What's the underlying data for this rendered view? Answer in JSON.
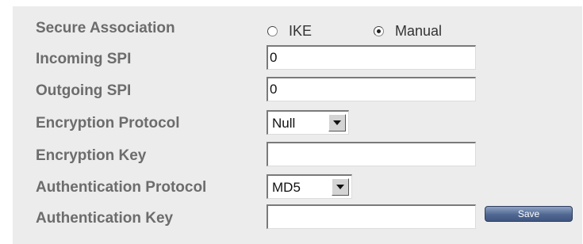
{
  "form": {
    "secure_association": {
      "label": "Secure Association",
      "options": [
        "IKE",
        "Manual"
      ],
      "selected": "Manual"
    },
    "incoming_spi": {
      "label": "Incoming SPI",
      "value": "0"
    },
    "outgoing_spi": {
      "label": "Outgoing SPI",
      "value": "0"
    },
    "encryption_protocol": {
      "label": "Encryption Protocol",
      "value": "Null"
    },
    "encryption_key": {
      "label": "Encryption Key",
      "value": ""
    },
    "authentication_protocol": {
      "label": "Authentication Protocol",
      "value": "MD5"
    },
    "authentication_key": {
      "label": "Authentication Key",
      "value": ""
    },
    "save_label": "Save"
  },
  "colors": {
    "panel_background": "#ececec",
    "label_text": "#6c6c6c",
    "button_blue": "#506892"
  }
}
